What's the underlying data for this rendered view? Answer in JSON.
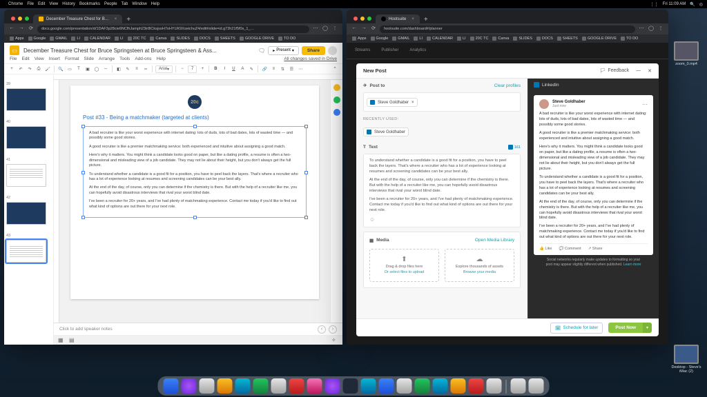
{
  "menubar": {
    "app": "Chrome",
    "items": [
      "File",
      "Edit",
      "View",
      "History",
      "Bookmarks",
      "People",
      "Tab",
      "Window",
      "Help"
    ],
    "right": [
      "Fri 11:09 AM"
    ]
  },
  "winL": {
    "tab": "December Treasure Chest for B…",
    "url": "docs.google.com/presentation/d/1DAF3p28cie6NCfhJamph23ir8lCksjsoH7oHYUK9XseichuZ4/edit#slide=id.g73h21f5f0s_1_…",
    "bookmarks": [
      "Apps",
      "Google",
      "GMAIL",
      "LI",
      "CALENDAR",
      "LI",
      "20C TC",
      "Canva",
      "SLIDES",
      "DOCS",
      "SHEETS",
      "GOOGLE DRIVE",
      "TO DO"
    ],
    "doc_title": "December Treasure Chest for Bruce  Springsteen at Bruce Springsteen & Ass...",
    "present": "Present",
    "share": "Share",
    "menus": [
      "File",
      "Edit",
      "View",
      "Insert",
      "Format",
      "Slide",
      "Arrange",
      "Tools",
      "Add-ons",
      "Help"
    ],
    "saved": "All changes saved in Drive",
    "font": "Arial",
    "thumbs": [
      "39",
      "40",
      "41",
      "42",
      "43"
    ],
    "slide": {
      "logo": "20c",
      "title": "Post #33 - Being a matchmaker (targeted at clients)",
      "paras": [
        "A bad recruiter is like your worst experience with internet dating: lots of duds, lots of bad dates, lots of wasted time — and possibly some good stories.",
        "A good recruiter is like a premier matchmaking service: both experienced and intuitive about assigning a good match.",
        "Here's why it matters. You might think a candidate looks good on paper, but like a dating profile, a resume is often a two-dimensional and misleading view of a job candidate. They may not lie about their height, but you don't always get the full picture.",
        "To understand whether a candidate is a good fit for a position, you have to peel back the layers. That's where a recruiter who has a lot of experience looking at resumes and screening candidates can be your best ally.",
        "At the end of the day, of course, only you can determine if the chemistry is there. But with the help of a recruiter like me, you can hopefully avoid disastrous interviews that rival your worst blind date.",
        "I've been a recruiter for 20+ years, and I've had plenty of matchmaking experience. Contact me today if you'd like to find out what kind of options are out there for your next role."
      ]
    },
    "speaker": "Click to add speaker notes"
  },
  "winR": {
    "tab": "Hootsuite",
    "url": "hootsuite.com/dashboard#/planner",
    "bookmarks": [
      "Apps",
      "Google",
      "GMAIL",
      "LI",
      "CALENDAR",
      "LI",
      "20C TC",
      "Canva",
      "SLIDES",
      "DOCS",
      "SHEETS",
      "GOOGLE DRIVE",
      "TO DO"
    ],
    "modal": {
      "title": "New Post",
      "feedback": "Feedback",
      "postto": {
        "label": "Post to",
        "clear": "Clear profiles",
        "chip": "Steve Goldhaber",
        "recent": "RECENTLY USED:",
        "recent_chip": "Steve Goldhaber"
      },
      "text": {
        "label": "Text",
        "count": "161",
        "paras": [
          "To understand whether a candidate is a good fit for a position, you have to peel back the layers. That's where a recruiter who has a lot of experience looking at resumes and screening candidates can be your best ally.",
          "At the end of the day, of course, only you can determine if the chemistry is there. But with the help of a recruiter like me, you can hopefully avoid disastrous interviews that rival your worst blind date.",
          "I've been a recruiter for 20+ years, and I've had plenty of matchmaking experience. Contact me today if you'd like to find out what kind of options are out there for your next role."
        ]
      },
      "media": {
        "label": "Media",
        "open": "Open Media Library",
        "drag": "Drag & drop files here",
        "select": "Or select files to upload",
        "explore": "Explore thousands of assets",
        "browse": "Browse your media"
      },
      "schedule": "Schedule for later",
      "postnow": "Post Now"
    },
    "preview": {
      "platform": "LinkedIn",
      "name": "Steve Goldhaber",
      "time": "Just now",
      "paras": [
        "A bad recruiter is like your worst experience with internet dating: lots of duds, lots of bad dates, lots of wasted time — and possibly some good stories.",
        "A good recruiter is like a premier matchmaking service: both experienced and intuitive about assigning a good match.",
        "Here's why it matters. You might think a candidate looks good on paper, but like a dating profile, a resume is often a two-dimensional and misleading view of a job candidate. They may not lie about their height, but you don't always get the full picture.",
        "To understand whether a candidate is a good fit for a position, you have to peel back the layers. That's where a recruiter who has a lot of experience looking at resumes and screening candidates can be your best ally.",
        "At the end of the day, of course, only you can determine if the chemistry is there. But with the help of a recruiter like me, you can hopefully avoid disastrous interviews that rival your worst blind date.",
        "I've been a recruiter for 20+ years, and I've had plenty of matchmaking experience. Contact me today if you'd like to find out what kind of options are out there for your next role."
      ],
      "actions": [
        "Like",
        "Comment",
        "Share"
      ],
      "note": "Social networks regularly make updates to formatting so your post may appear slightly different when published.",
      "learn": "Learn more"
    }
  },
  "desktop": {
    "file1": "zoom_0.mp4",
    "file2": "Desktop - Steve's iMac (2)"
  }
}
